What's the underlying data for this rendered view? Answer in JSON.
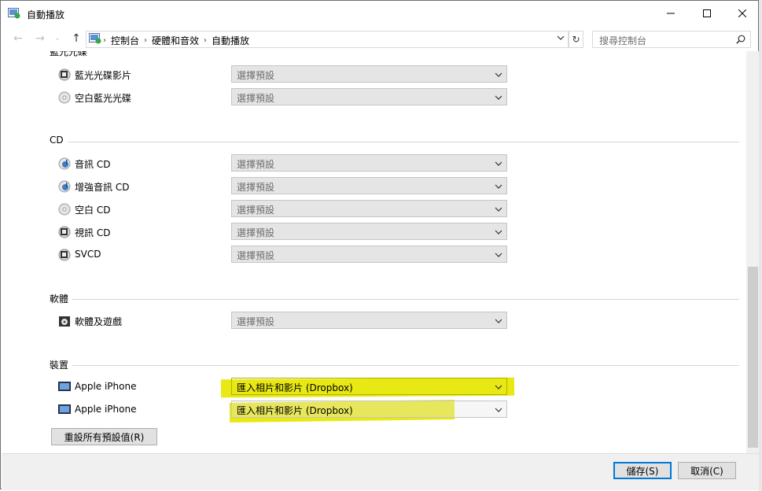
{
  "window": {
    "title": "自動播放"
  },
  "address": {
    "crumbs": [
      "控制台",
      "硬體和音效",
      "自動播放"
    ],
    "search_placeholder": "搜尋控制台"
  },
  "sections": {
    "bluray_partial": "藍光光碟",
    "bluray_items": [
      {
        "label": "藍光光碟影片",
        "value": "選擇預設"
      },
      {
        "label": "空白藍光光碟",
        "value": "選擇預設"
      }
    ],
    "cd": "CD",
    "cd_items": [
      {
        "label": "音訊 CD",
        "value": "選擇預設"
      },
      {
        "label": "增強音訊 CD",
        "value": "選擇預設"
      },
      {
        "label": "空白 CD",
        "value": "選擇預設"
      },
      {
        "label": "視訊 CD",
        "value": "選擇預設"
      },
      {
        "label": "SVCD",
        "value": "選擇預設"
      }
    ],
    "software": "軟體",
    "software_items": [
      {
        "label": "軟體及遊戲",
        "value": "選擇預設"
      }
    ],
    "devices": "裝置",
    "device_items": [
      {
        "label": "Apple iPhone",
        "value": "匯入相片和影片 (Dropbox)"
      },
      {
        "label": "Apple iPhone",
        "value": "匯入相片和影片 (Dropbox)"
      }
    ]
  },
  "buttons": {
    "reset": "重設所有預設值(R)",
    "save": "儲存(S)",
    "cancel": "取消(C)"
  },
  "colors": {
    "highlight": "#e6e600",
    "accent": "#0078d7"
  }
}
